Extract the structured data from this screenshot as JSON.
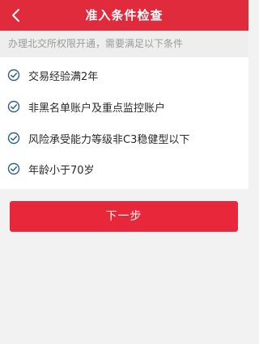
{
  "header": {
    "title": "准入条件检查",
    "back_icon": "chevron-left-icon",
    "background": "#e02b3d"
  },
  "notice": {
    "text": "办理北交所权限开通，需要满足以下条件"
  },
  "conditions": [
    {
      "label": "交易经验满2年",
      "icon": "check-circle-icon"
    },
    {
      "label": "非黑名单账户及重点监控账户",
      "icon": "check-circle-icon"
    },
    {
      "label": "风险承受能力等级非C3稳健型以下",
      "icon": "check-circle-icon"
    },
    {
      "label": "年龄小于70岁",
      "icon": "check-circle-icon"
    }
  ],
  "actions": {
    "next_label": "下一步"
  },
  "colors": {
    "accent": "#e8283a",
    "check_icon": "#2f5f8a"
  }
}
